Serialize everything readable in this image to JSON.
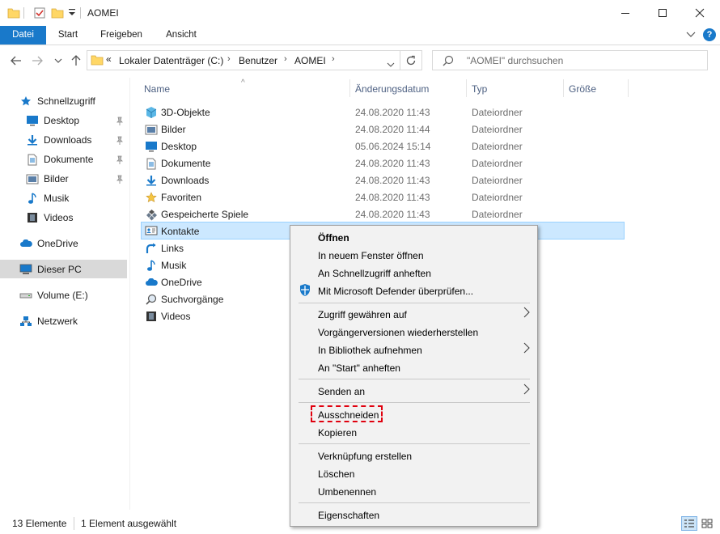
{
  "window": {
    "title": "AOMEI"
  },
  "ribbon": {
    "tabs": [
      "Datei",
      "Start",
      "Freigeben",
      "Ansicht"
    ]
  },
  "address": {
    "overflow": "«",
    "crumbs": [
      "Lokaler Datenträger (C:)",
      "Benutzer",
      "AOMEI"
    ],
    "search_placeholder": "\"AOMEI\" durchsuchen"
  },
  "sidebar": {
    "quick_access": "Schnellzugriff",
    "quick_items": [
      "Desktop",
      "Downloads",
      "Dokumente",
      "Bilder",
      "Musik",
      "Videos"
    ],
    "onedrive": "OneDrive",
    "this_pc": "Dieser PC",
    "volume": "Volume (E:)",
    "network": "Netzwerk"
  },
  "columns": [
    "Name",
    "Änderungsdatum",
    "Typ",
    "Größe"
  ],
  "files": [
    {
      "name": "3D-Objekte",
      "date": "24.08.2020 11:43",
      "type": "Dateiordner",
      "icon": "3d-objects-icon"
    },
    {
      "name": "Bilder",
      "date": "24.08.2020 11:44",
      "type": "Dateiordner",
      "icon": "pictures-icon"
    },
    {
      "name": "Desktop",
      "date": "05.06.2024 15:14",
      "type": "Dateiordner",
      "icon": "desktop-icon"
    },
    {
      "name": "Dokumente",
      "date": "24.08.2020 11:43",
      "type": "Dateiordner",
      "icon": "documents-icon"
    },
    {
      "name": "Downloads",
      "date": "24.08.2020 11:43",
      "type": "Dateiordner",
      "icon": "downloads-icon"
    },
    {
      "name": "Favoriten",
      "date": "24.08.2020 11:43",
      "type": "Dateiordner",
      "icon": "favorites-icon"
    },
    {
      "name": "Gespeicherte Spiele",
      "date": "24.08.2020 11:43",
      "type": "Dateiordner",
      "icon": "saved-games-icon"
    },
    {
      "name": "Kontakte",
      "date": "",
      "type": "",
      "icon": "contacts-icon"
    },
    {
      "name": "Links",
      "date": "",
      "type": "",
      "icon": "links-icon"
    },
    {
      "name": "Musik",
      "date": "",
      "type": "",
      "icon": "music-icon"
    },
    {
      "name": "OneDrive",
      "date": "",
      "type": "",
      "icon": "onedrive-icon"
    },
    {
      "name": "Suchvorgänge",
      "date": "",
      "type": "",
      "icon": "searches-icon"
    },
    {
      "name": "Videos",
      "date": "",
      "type": "",
      "icon": "videos-icon"
    }
  ],
  "context_menu": {
    "open": "Öffnen",
    "open_new_window": "In neuem Fenster öffnen",
    "pin_quick_access": "An Schnellzugriff anheften",
    "defender": "Mit Microsoft Defender überprüfen...",
    "give_access": "Zugriff gewähren auf",
    "restore_versions": "Vorgängerversionen wiederherstellen",
    "include_library": "In Bibliothek aufnehmen",
    "pin_start": "An \"Start\" anheften",
    "send_to": "Senden an",
    "cut": "Ausschneiden",
    "copy": "Kopieren",
    "create_shortcut": "Verknüpfung erstellen",
    "delete": "Löschen",
    "rename": "Umbenennen",
    "properties": "Eigenschaften"
  },
  "status": {
    "count": "13 Elemente",
    "selected": "1 Element ausgewählt"
  },
  "colors": {
    "accent": "#1979ca",
    "selection": "#cce8ff",
    "highlight_border": "#e0000e",
    "folder": "#ffd766"
  }
}
